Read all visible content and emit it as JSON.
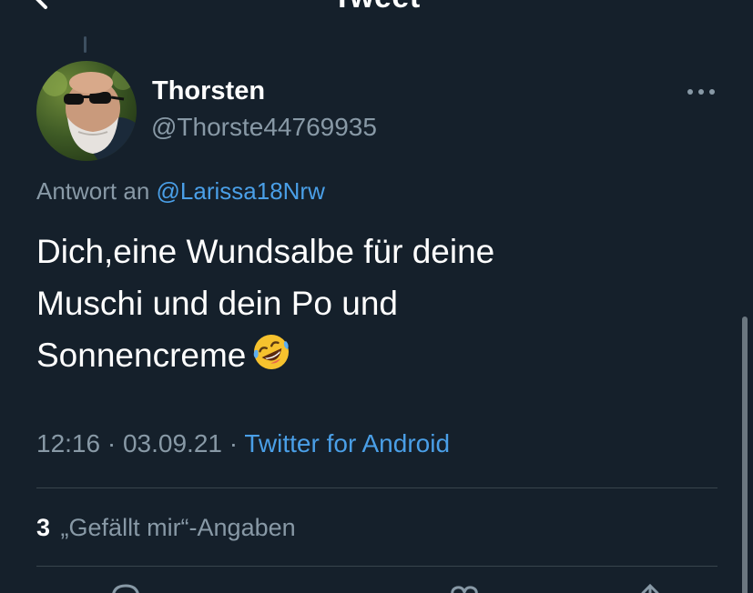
{
  "header": {
    "title": "Tweet",
    "back_icon": "chevron-left-icon"
  },
  "tweet": {
    "author": {
      "display_name": "Thorsten",
      "handle": "@Thorste44769935"
    },
    "reply_context": {
      "prefix": "Antwort an",
      "mention": "@Larissa18Nrw"
    },
    "text_lines": [
      "Dich,eine Wundsalbe für deine",
      "Muschi und dein Po und",
      "Sonnencreme"
    ],
    "emoji": "rolling-on-the-floor-laughing",
    "time": "12:16",
    "date": "03.09.21",
    "separator": "·",
    "source": "Twitter for Android",
    "likes": {
      "count": "3",
      "label": "„Gefällt mir“-Angaben"
    }
  },
  "colors": {
    "background": "#15202b",
    "secondary_text": "#8899a6",
    "link": "#4a9fe7",
    "divider": "#38444d"
  }
}
